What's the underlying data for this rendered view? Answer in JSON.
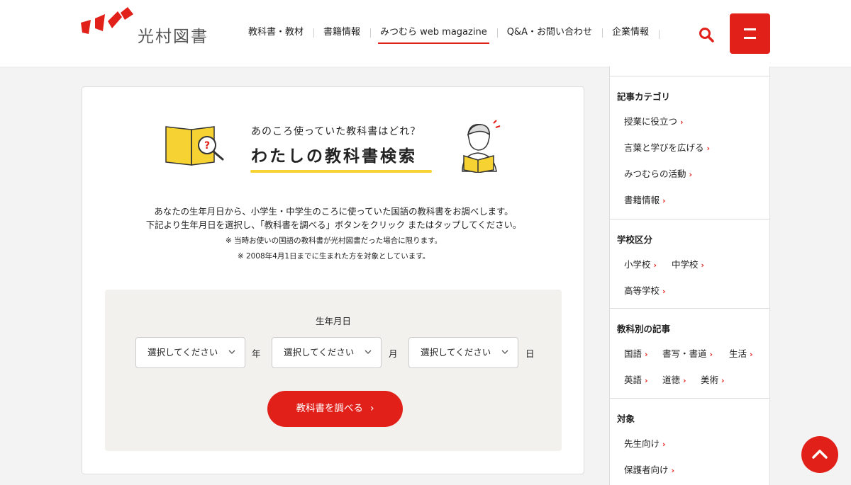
{
  "header": {
    "logo_text": "光村図書",
    "nav": [
      {
        "label": "教科書・教材",
        "active": false
      },
      {
        "label": "書籍情報",
        "active": false
      },
      {
        "label": "みつむら web magazine",
        "active": true
      },
      {
        "label": "Q&A・お問い合わせ",
        "active": false
      },
      {
        "label": "企業情報",
        "active": false
      }
    ],
    "search_icon": "search-icon",
    "menu_icon": "menu-icon",
    "accent_color": "#e2201a"
  },
  "hero": {
    "subtitle": "あのころ使っていた教科書はどれ？",
    "title": "わたしの教科書検索",
    "underline_color": "#f6d332"
  },
  "description": {
    "line1": "あなたの生年月日から、小学生・中学生のころに使っていた国語の教科書をお調べします。",
    "line2": "下記より生年月日を選択し、「教科書を調べる」ボタンをクリック またはタップしてください。",
    "note1": "※ 当時お使いの国語の教科書が光村図書だった場合に限ります。",
    "note2": "※ 2008年4月1日までに生まれた方を対象としています。"
  },
  "form": {
    "label": "生年月日",
    "year": {
      "value": "選択してください",
      "unit": "年"
    },
    "month": {
      "value": "選択してください",
      "unit": "月"
    },
    "day": {
      "value": "選択してください",
      "unit": "日"
    },
    "submit_label": "教科書を調べる",
    "submit_arrow": "›"
  },
  "sidebar": {
    "categories": {
      "heading": "記事カテゴリ",
      "items": [
        "授業に役立つ",
        "言葉と学びを広げる",
        "みつむらの活動",
        "書籍情報"
      ]
    },
    "school": {
      "heading": "学校区分",
      "items": [
        "小学校",
        "中学校",
        "高等学校"
      ]
    },
    "subjects": {
      "heading": "教科別の記事",
      "items": [
        "国語",
        "書写・書道",
        "生活",
        "英語",
        "道徳",
        "美術"
      ]
    },
    "audience": {
      "heading": "対象",
      "items": [
        "先生向け",
        "保護者向け"
      ]
    },
    "chevron": "›"
  },
  "back_to_top": "chevron-up-icon"
}
